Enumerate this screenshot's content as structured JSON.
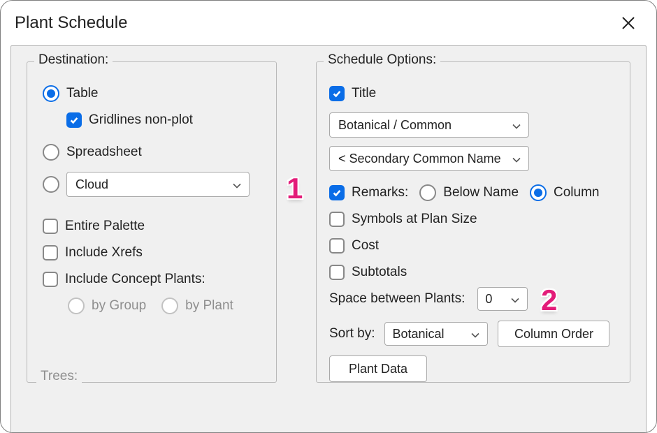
{
  "title": "Plant Schedule",
  "destination": {
    "legend": "Destination:",
    "radios": {
      "table": "Table",
      "spreadsheet": "Spreadsheet",
      "cloud_value": "Cloud"
    },
    "gridlines": "Gridlines non-plot",
    "entire_palette": "Entire Palette",
    "include_xrefs": "Include Xrefs",
    "include_concept": "Include Concept Plants:",
    "by_group": "by Group",
    "by_plant": "by Plant"
  },
  "options": {
    "legend": "Schedule Options:",
    "title_chk": "Title",
    "name_format": "Botanical / Common",
    "secondary": "< Secondary Common Name",
    "remarks": "Remarks:",
    "below_name": "Below Name",
    "column": "Column",
    "symbols": "Symbols at Plan Size",
    "cost": "Cost",
    "subtotals": "Subtotals",
    "space_between": "Space between Plants:",
    "space_value": "0",
    "sort_by": "Sort by:",
    "sort_value": "Botanical",
    "column_order": "Column Order",
    "plant_data": "Plant Data"
  },
  "trees_label": "Trees:",
  "anno": {
    "one": "1",
    "two": "2"
  }
}
